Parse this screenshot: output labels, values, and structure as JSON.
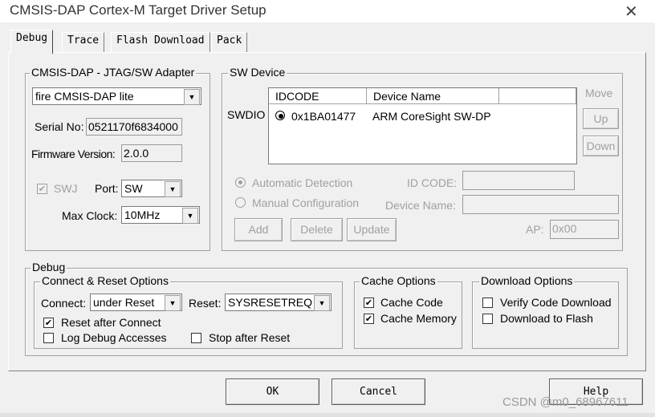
{
  "window": {
    "title": "CMSIS-DAP Cortex-M Target Driver Setup",
    "close_glyph": "✕"
  },
  "tabs": [
    {
      "label": "Debug"
    },
    {
      "label": "Trace"
    },
    {
      "label": "Flash Download"
    },
    {
      "label": "Pack"
    }
  ],
  "adapter": {
    "legend": "CMSIS-DAP - JTAG/SW Adapter",
    "selected": "fire CMSIS-DAP lite",
    "serial_label": "Serial No:",
    "serial_value": "0521170f6834000",
    "firmware_label": "Firmware Version:",
    "firmware_value": "2.0.0",
    "swj_label": "SWJ",
    "port_label": "Port:",
    "port_value": "SW",
    "maxclock_label": "Max Clock:",
    "maxclock_value": "10MHz"
  },
  "sw_device": {
    "legend": "SW Device",
    "row_label": "SWDIO",
    "columns": [
      "IDCODE",
      "Device Name"
    ],
    "rows": [
      {
        "idcode": "0x1BA01477",
        "device_name": "ARM CoreSight SW-DP"
      }
    ],
    "move_label": "Move",
    "up_label": "Up",
    "down_label": "Down",
    "auto_detect_label": "Automatic Detection",
    "manual_config_label": "Manual Configuration",
    "idcode_label": "ID CODE:",
    "device_name_label": "Device Name:",
    "add_label": "Add",
    "delete_label": "Delete",
    "update_label": "Update",
    "ap_label": "AP:",
    "ap_value": "0x00"
  },
  "debug": {
    "legend": "Debug",
    "connect_reset_legend": "Connect & Reset Options",
    "connect_label": "Connect:",
    "connect_value": "under Reset",
    "reset_label": "Reset:",
    "reset_value": "SYSRESETREQ",
    "reset_after_connect": "Reset after Connect",
    "log_debug_accesses": "Log Debug Accesses",
    "stop_after_reset": "Stop after Reset",
    "cache_legend": "Cache Options",
    "cache_code": "Cache Code",
    "cache_memory": "Cache Memory",
    "download_legend": "Download Options",
    "verify_code_download": "Verify Code Download",
    "download_to_flash": "Download to Flash"
  },
  "footer": {
    "ok_label": "OK",
    "cancel_label": "Cancel",
    "help_label": "Help"
  },
  "watermark": "CSDN @m0_68967611"
}
